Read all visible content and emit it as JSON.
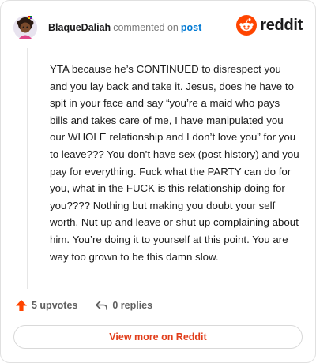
{
  "header": {
    "username": "BlaqueDaliah",
    "action_text": "commented on",
    "post_link": "post",
    "brand": "reddit"
  },
  "comment": {
    "body": "YTA because he’s CONTINUED to disrespect you and you lay back and take it. Jesus, does he have to spit in your face and say “you’re a maid who pays bills and takes care of me, I have manipulated you our WHOLE relationship and I don’t love you” for you to leave??? You don’t have sex (post history) and you pay for everything. Fuck what the PARTY can do for you, what in the FUCK is this relationship doing for you???? Nothing but making you doubt your self worth. Nut up and leave or shut up complaining about him. You’re doing it to yourself at this point. You are way too grown to be this damn slow."
  },
  "actions": {
    "upvotes": "5 upvotes",
    "replies": "0 replies"
  },
  "footer": {
    "view_more": "View more on Reddit"
  },
  "colors": {
    "brand_orange": "#ff4500",
    "link_blue": "#0079d3",
    "view_more_red": "#e13e1b",
    "upvote_orange": "#ff4500"
  },
  "icons": {
    "avatar": "avatar-icon",
    "reddit_logo": "reddit-logo-icon",
    "upvote": "upvote-arrow-icon",
    "reply": "reply-arrow-icon"
  }
}
